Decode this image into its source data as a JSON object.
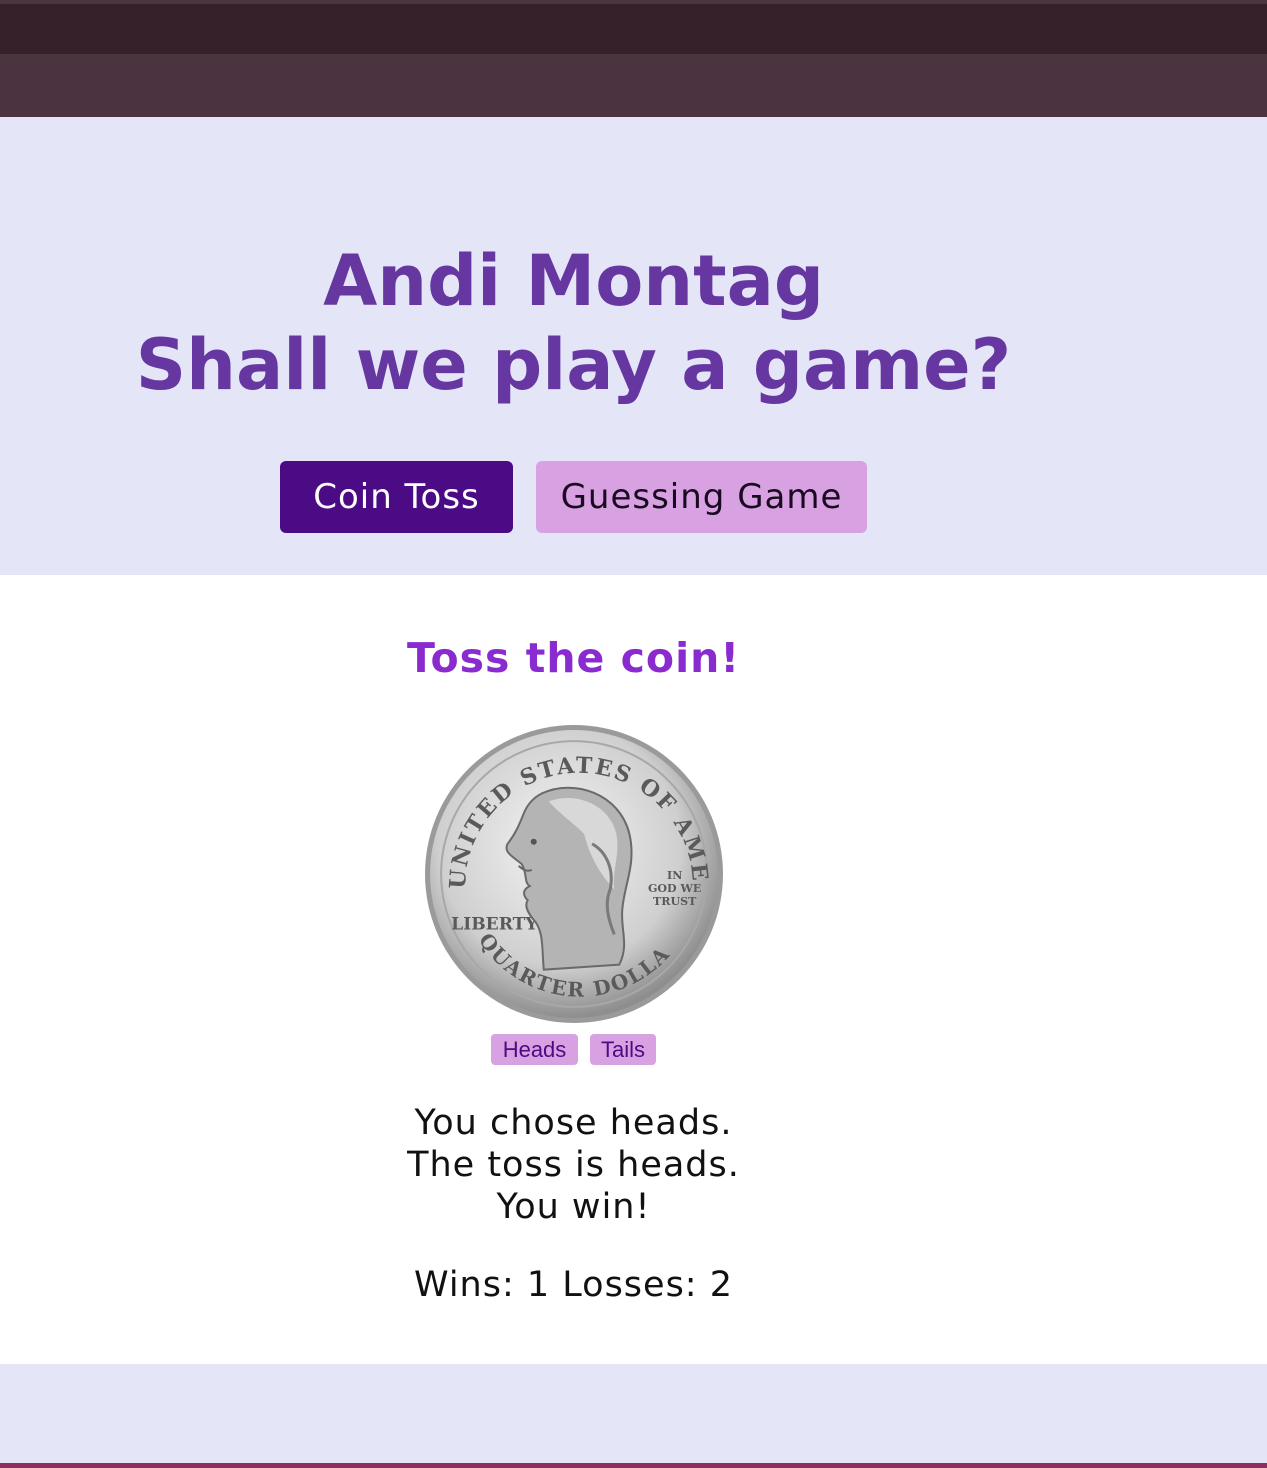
{
  "header": {
    "name": "Andi Montag",
    "tagline": "Shall we play a game?"
  },
  "nav": {
    "coin_toss_label": "Coin Toss",
    "guessing_game_label": "Guessing Game",
    "active": "Coin Toss"
  },
  "game": {
    "title": "Toss the coin!",
    "coin": {
      "top_text": "UNITED STATES OF AMERICA",
      "motto": [
        "IN",
        "GOD WE",
        "TRUST"
      ],
      "left_text": "LIBERTY",
      "bottom_text": "QUARTER DOLLAR"
    },
    "heads_label": "Heads",
    "tails_label": "Tails",
    "result": {
      "choice_text": "You chose heads.",
      "toss_text": "The toss is heads.",
      "outcome_text": "You win!",
      "score_text": "Wins: 1 Losses: 2"
    }
  },
  "colors": {
    "title": "#6637a0",
    "active_button": "#4b0b85",
    "inactive_button": "#d8a1e2",
    "game_title": "#8a2bd0",
    "header_bg": "#e5e5f8"
  }
}
